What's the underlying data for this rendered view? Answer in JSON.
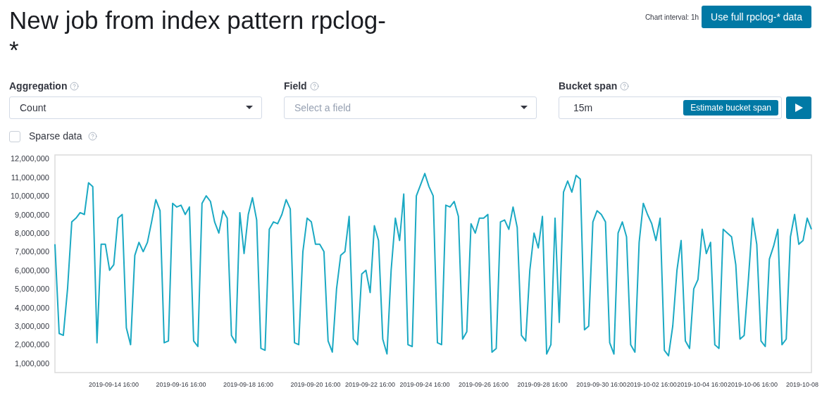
{
  "header": {
    "title": "New job from index pattern rpclog-*",
    "chart_interval": "Chart interval: 1h",
    "full_data_button": "Use full rpclog-* data"
  },
  "fields": [
    {
      "kind": "select",
      "label": "Aggregation",
      "value": "Count"
    },
    {
      "kind": "select",
      "label": "Field",
      "placeholder": "Select a field"
    },
    {
      "kind": "bucket",
      "label": "Bucket span",
      "value": "15m",
      "estimate_button": "Estimate bucket span"
    }
  ],
  "sparse_data": {
    "label": "Sparse data",
    "checked": false
  },
  "chart": {
    "chart_data": {
      "type": "line",
      "categories": [
        null,
        null,
        null,
        null,
        null,
        null,
        null,
        null,
        null,
        null,
        null,
        null,
        null,
        null,
        "2019-09-14 16:00",
        null,
        null,
        null,
        null,
        null,
        null,
        null,
        null,
        null,
        null,
        null,
        null,
        null,
        null,
        null,
        "2019-09-16 16:00",
        null,
        null,
        null,
        null,
        null,
        null,
        null,
        null,
        null,
        null,
        null,
        null,
        null,
        null,
        null,
        "2019-09-18 16:00",
        null,
        null,
        null,
        null,
        null,
        null,
        null,
        null,
        null,
        null,
        null,
        null,
        null,
        null,
        null,
        "2019-09-20 16:00",
        null,
        null,
        null,
        null,
        null,
        null,
        null,
        null,
        null,
        null,
        null,
        null,
        "2019-09-22 16:00",
        null,
        null,
        null,
        null,
        null,
        null,
        null,
        null,
        null,
        null,
        null,
        null,
        "2019-09-24 16:00",
        null,
        null,
        null,
        null,
        null,
        null,
        null,
        null,
        null,
        null,
        null,
        null,
        null,
        "2019-09-26 16:00",
        null,
        null,
        null,
        null,
        null,
        null,
        null,
        null,
        null,
        null,
        null,
        null,
        null,
        "2019-09-28 16:00",
        null,
        null,
        null,
        null,
        null,
        null,
        null,
        null,
        null,
        null,
        null,
        null,
        null,
        "2019-09-30 16:00",
        null,
        null,
        null,
        null,
        null,
        null,
        null,
        null,
        null,
        null,
        null,
        "2019-10-02 16:00",
        null,
        null,
        null,
        null,
        null,
        null,
        null,
        null,
        null,
        null,
        null,
        "2019-10-04 16:00",
        null,
        null,
        null,
        null,
        null,
        null,
        null,
        null,
        null,
        null,
        null,
        "2019-10-06 16:00",
        null,
        null,
        null,
        null,
        null,
        null,
        null,
        null,
        null,
        null,
        null,
        "2019-10-08",
        null,
        null
      ],
      "series": [
        {
          "color": "#1ba9c3",
          "values": [
            7400000,
            2600000,
            2500000,
            5000000,
            8600000,
            8800000,
            9100000,
            9000000,
            10700000,
            10500000,
            2100000,
            7400000,
            7400000,
            6000000,
            6300000,
            8800000,
            9000000,
            2900000,
            2000000,
            6800000,
            7500000,
            7000000,
            7500000,
            8600000,
            9800000,
            9200000,
            2100000,
            2200000,
            9600000,
            9400000,
            9500000,
            9000000,
            9400000,
            2200000,
            1900000,
            9600000,
            10000000,
            9700000,
            8600000,
            8000000,
            9200000,
            8800000,
            2500000,
            2100000,
            9100000,
            6900000,
            9000000,
            9900000,
            8700000,
            1800000,
            1700000,
            8200000,
            8600000,
            8500000,
            9000000,
            9800000,
            9300000,
            2100000,
            2000000,
            7000000,
            8800000,
            8600000,
            7400000,
            7400000,
            7000000,
            2200000,
            1600000,
            5000000,
            6800000,
            7000000,
            8900000,
            2300000,
            2000000,
            5800000,
            6000000,
            4800000,
            8400000,
            7600000,
            2300000,
            1500000,
            6000000,
            8800000,
            7600000,
            10100000,
            2000000,
            1900000,
            10000000,
            10600000,
            11200000,
            10500000,
            10000000,
            2100000,
            2000000,
            9500000,
            9400000,
            9700000,
            8900000,
            2300000,
            2700000,
            8500000,
            8000000,
            8800000,
            8800000,
            9000000,
            1600000,
            1800000,
            8600000,
            8700000,
            8200000,
            9400000,
            8300000,
            2500000,
            2200000,
            6000000,
            8000000,
            7200000,
            8900000,
            1500000,
            2000000,
            8800000,
            3200000,
            10200000,
            10800000,
            10200000,
            11100000,
            10900000,
            2800000,
            3000000,
            8600000,
            9200000,
            9000000,
            8600000,
            2100000,
            1500000,
            8000000,
            8600000,
            7800000,
            2000000,
            1600000,
            7500000,
            9600000,
            9000000,
            8500000,
            7600000,
            8800000,
            1700000,
            1400000,
            3000000,
            6000000,
            7600000,
            2200000,
            1800000,
            5000000,
            5500000,
            8200000,
            6900000,
            7500000,
            2000000,
            1800000,
            8200000,
            8000000,
            7800000,
            6300000,
            2300000,
            2500000,
            5500000,
            8800000,
            7400000,
            2200000,
            1900000,
            6600000,
            7300000,
            8200000,
            2000000,
            2300000,
            7800000,
            9000000,
            7400000,
            7600000,
            8800000,
            8200000
          ]
        }
      ],
      "ylim": [
        500000,
        12200000
      ],
      "yticks": [
        {
          "value": 1000000,
          "label": "1,000,000"
        },
        {
          "value": 2000000,
          "label": "2,000,000"
        },
        {
          "value": 3000000,
          "label": "3,000,000"
        },
        {
          "value": 4000000,
          "label": "4,000,000"
        },
        {
          "value": 5000000,
          "label": "5,000,000"
        },
        {
          "value": 6000000,
          "label": "6,000,000"
        },
        {
          "value": 7000000,
          "label": "7,000,000"
        },
        {
          "value": 8000000,
          "label": "8,000,000"
        },
        {
          "value": 9000000,
          "label": "9,000,000"
        },
        {
          "value": 10000000,
          "label": "10,000,000"
        },
        {
          "value": 11000000,
          "label": "11,000,000"
        },
        {
          "value": 12000000,
          "label": "12,000,000"
        }
      ]
    }
  }
}
